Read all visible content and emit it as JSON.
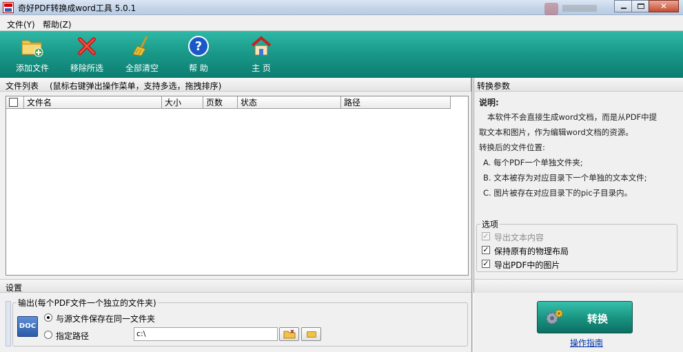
{
  "window": {
    "title": "奇好PDF转换成word工具 5.0.1"
  },
  "menu": [
    {
      "label": "文件(Y)"
    },
    {
      "label": "帮助(Z)"
    }
  ],
  "toolbar": {
    "add_files": "添加文件",
    "remove_selected": "移除所选",
    "clear_all": "全部清空",
    "help": "帮 助",
    "home": "主 页"
  },
  "file_list": {
    "header": "文件列表",
    "hint": "(鼠标右键弹出操作菜单，支持多选，拖拽排序)",
    "columns": [
      "文件名",
      "大小",
      "页数",
      "状态",
      "路径"
    ]
  },
  "params": {
    "header": "转换参数",
    "desc_title": "说明:",
    "desc_line1": "本软件不会直接生成word文档，而是从PDF中提",
    "desc_line2": "取文本和图片，作为编辑word文档的资源。",
    "location_title": "转换后的文件位置:",
    "loc_a": "A. 每个PDF一个单独文件夹;",
    "loc_b": "B. 文本被存为对应目录下一个单独的文本文件;",
    "loc_c": "C. 图片被存在对应目录下的pic子目录内。",
    "options_legend": "选项",
    "options": [
      {
        "label": "导出文本内容",
        "checked": true,
        "disabled": true
      },
      {
        "label": "保持原有的物理布局",
        "checked": true,
        "disabled": false
      },
      {
        "label": "导出PDF中的图片",
        "checked": true,
        "disabled": false
      }
    ]
  },
  "settings": {
    "header": "设置",
    "output_legend": "输出(每个PDF文件一个独立的文件夹)",
    "doc_icon_text": "DOC",
    "radio_same": "与源文件保存在同一文件夹",
    "radio_custom": "指定路径",
    "path_value": "c:\\"
  },
  "convert": {
    "button": "转换",
    "guide": "操作指南"
  },
  "colors": {
    "toolbar_teal": "#1a9a8a",
    "link": "#0033aa"
  }
}
